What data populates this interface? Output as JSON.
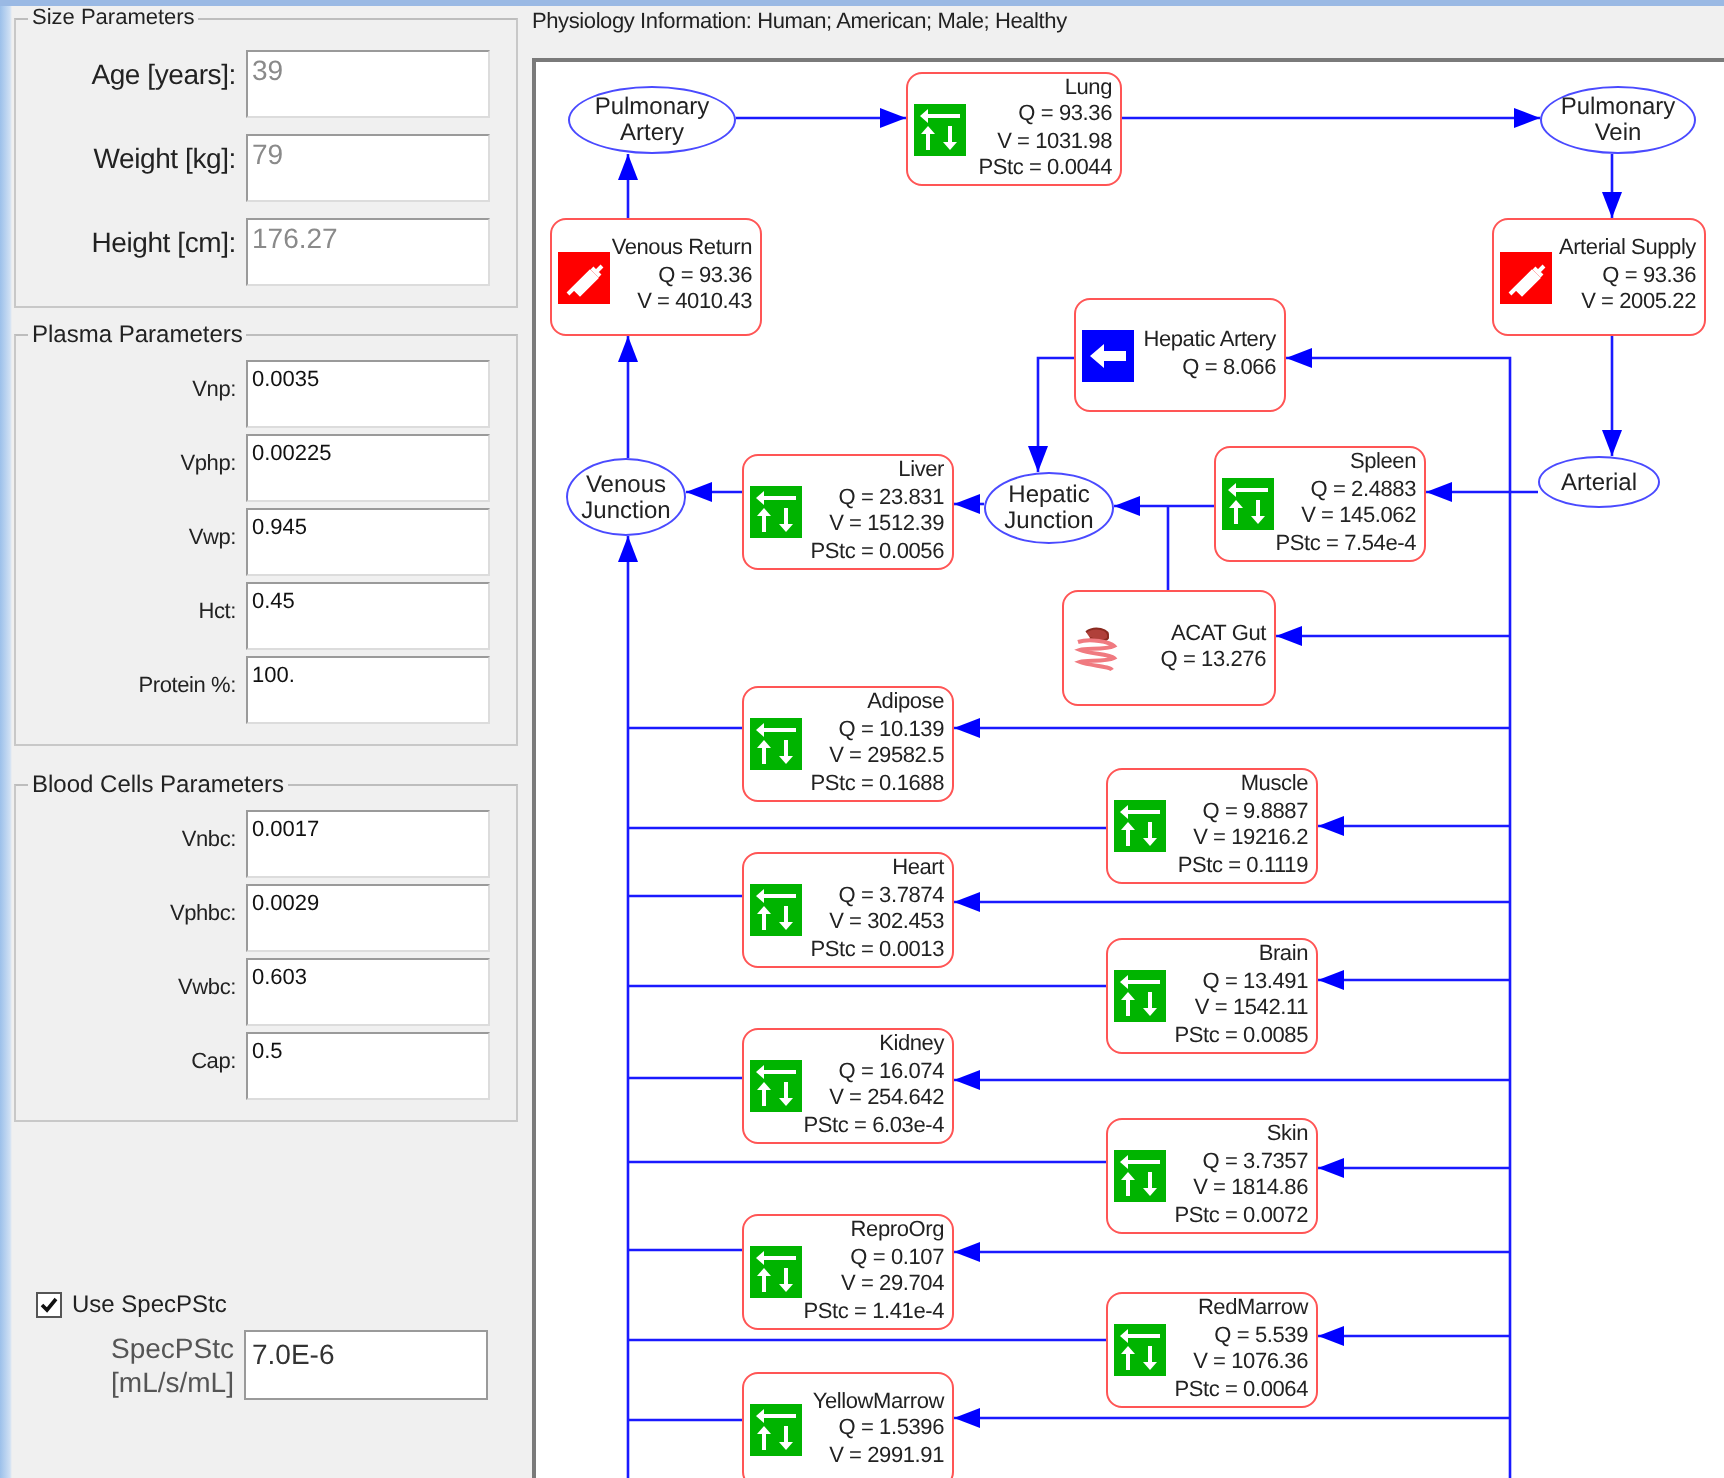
{
  "groups": [
    {
      "title": "Size Parameters",
      "kind": "large",
      "fields": [
        {
          "label": "Age [years]:",
          "value": "39",
          "disabled": true
        },
        {
          "label": "Weight [kg]:",
          "value": "79",
          "disabled": true
        },
        {
          "label": "Height [cm]:",
          "value": "176.27",
          "disabled": true
        }
      ]
    },
    {
      "title": "Plasma Parameters",
      "kind": "small",
      "fields": [
        {
          "label": "Vnp:",
          "value": "0.0035",
          "disabled": false
        },
        {
          "label": "Vphp:",
          "value": "0.00225",
          "disabled": false
        },
        {
          "label": "Vwp:",
          "value": "0.945",
          "disabled": false
        },
        {
          "label": "Hct:",
          "value": "0.45",
          "disabled": false
        },
        {
          "label": "Protein %:",
          "value": "100.",
          "disabled": false
        }
      ]
    },
    {
      "title": "Blood Cells Parameters",
      "kind": "small",
      "fields": [
        {
          "label": "Vnbc:",
          "value": "0.0017",
          "disabled": false
        },
        {
          "label": "Vphbc:",
          "value": "0.0029",
          "disabled": false
        },
        {
          "label": "Vwbc:",
          "value": "0.603",
          "disabled": false
        },
        {
          "label": "Cap:",
          "value": "0.5",
          "disabled": false
        }
      ]
    }
  ],
  "spec": {
    "checkbox_label": "Use SpecPStc",
    "checked": true,
    "label_lines": [
      "SpecPStc",
      "[mL/s/mL]"
    ],
    "value": "7.0E-6"
  },
  "diagram": {
    "title": "Physiology Information: Human;  American;  Male;  Healthy",
    "nodes": [
      {
        "kind": "junction",
        "label": "Pulmonary Artery"
      },
      {
        "kind": "organ",
        "label": "Lung",
        "lines": [
          "Q = 93.36",
          "V = 1031.98",
          "PStc = 0.0044"
        ]
      },
      {
        "kind": "junction",
        "label": "Pulmonary Vein"
      },
      {
        "kind": "blood",
        "label": "Venous Return",
        "lines": [
          "Q = 93.36",
          "V = 4010.43"
        ]
      },
      {
        "kind": "blood",
        "label": "Arterial Supply",
        "lines": [
          "Q = 93.36",
          "V = 2005.22"
        ]
      },
      {
        "kind": "artery",
        "label": "Hepatic Artery",
        "lines": [
          "Q = 8.066"
        ]
      },
      {
        "kind": "junction",
        "label": "Venous Junction"
      },
      {
        "kind": "organ",
        "label": "Liver",
        "lines": [
          "Q = 23.831",
          "V = 1512.39",
          "PStc = 0.0056"
        ]
      },
      {
        "kind": "junction",
        "label": "Hepatic Junction"
      },
      {
        "kind": "organ",
        "label": "Spleen",
        "lines": [
          "Q = 2.4883",
          "V = 145.062",
          "PStc = 7.54e-4"
        ]
      },
      {
        "kind": "junction",
        "label": "Arterial"
      },
      {
        "kind": "gut",
        "label": "ACAT Gut",
        "lines": [
          "Q = 13.276"
        ]
      },
      {
        "kind": "organ",
        "label": "Adipose",
        "lines": [
          "Q = 10.139",
          "V = 29582.5",
          "PStc = 0.1688"
        ]
      },
      {
        "kind": "organ",
        "label": "Muscle",
        "lines": [
          "Q = 9.8887",
          "V = 19216.2",
          "PStc = 0.1119"
        ]
      },
      {
        "kind": "organ",
        "label": "Heart",
        "lines": [
          "Q = 3.7874",
          "V = 302.453",
          "PStc = 0.0013"
        ]
      },
      {
        "kind": "organ",
        "label": "Brain",
        "lines": [
          "Q = 13.491",
          "V = 1542.11",
          "PStc = 0.0085"
        ]
      },
      {
        "kind": "organ",
        "label": "Kidney",
        "lines": [
          "Q = 16.074",
          "V = 254.642",
          "PStc = 6.03e-4"
        ]
      },
      {
        "kind": "organ",
        "label": "Skin",
        "lines": [
          "Q = 3.7357",
          "V = 1814.86",
          "PStc = 0.0072"
        ]
      },
      {
        "kind": "organ",
        "label": "ReproOrg",
        "lines": [
          "Q = 0.107",
          "V = 29.704",
          "PStc = 1.41e-4"
        ]
      },
      {
        "kind": "organ",
        "label": "RedMarrow",
        "lines": [
          "Q = 5.539",
          "V = 1076.36",
          "PStc = 0.0064"
        ]
      },
      {
        "kind": "organ",
        "label": "YellowMarrow",
        "lines": [
          "Q = 1.5396",
          "V = 2991.91"
        ]
      }
    ]
  }
}
